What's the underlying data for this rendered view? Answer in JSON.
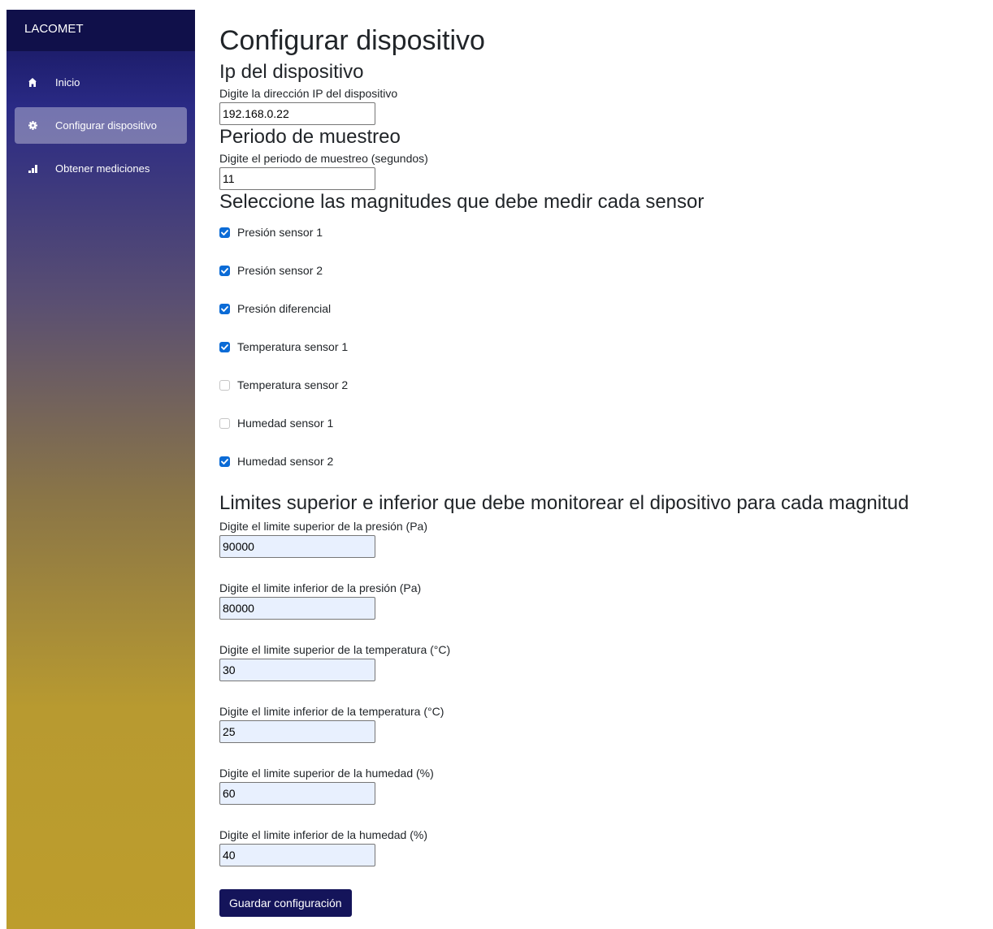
{
  "sidebar": {
    "brand": "LACOMET",
    "items": [
      {
        "label": "Inicio",
        "icon": "home-icon",
        "active": false
      },
      {
        "label": "Configurar dispositivo",
        "icon": "gear-icon",
        "active": true
      },
      {
        "label": "Obtener mediciones",
        "icon": "bar-chart-icon",
        "active": false
      }
    ]
  },
  "page": {
    "title": "Configurar dispositivo"
  },
  "ip_section": {
    "heading": "Ip del dispositivo",
    "label": "Digite la dirección IP del dispositivo",
    "value": "192.168.0.22"
  },
  "sampling_section": {
    "heading": "Periodo de muestreo",
    "label": "Digite el periodo de muestreo (segundos)",
    "value": "11"
  },
  "magnitudes_section": {
    "heading": "Seleccione las magnitudes que debe medir cada sensor",
    "options": [
      {
        "label": "Presión sensor 1",
        "checked": true
      },
      {
        "label": "Presión sensor 2",
        "checked": true
      },
      {
        "label": "Presión diferencial",
        "checked": true
      },
      {
        "label": "Temperatura sensor 1",
        "checked": true
      },
      {
        "label": "Temperatura sensor 2",
        "checked": false
      },
      {
        "label": "Humedad sensor 1",
        "checked": false
      },
      {
        "label": "Humedad sensor 2",
        "checked": true
      }
    ]
  },
  "limits_section": {
    "heading": "Limites superior e inferior que debe monitorear el dipositivo para cada magnitud",
    "fields": [
      {
        "label": "Digite el limite superior de la presión (Pa)",
        "value": "90000"
      },
      {
        "label": "Digite el limite inferior de la presión (Pa)",
        "value": "80000"
      },
      {
        "label": "Digite el limite superior de la temperatura (°C)",
        "value": "30"
      },
      {
        "label": "Digite el limite inferior de la temperatura (°C)",
        "value": "25"
      },
      {
        "label": "Digite el limite superior de la humedad (%)",
        "value": "60"
      },
      {
        "label": "Digite el limite inferior de la humedad (%)",
        "value": "40"
      }
    ]
  },
  "actions": {
    "save_label": "Guardar configuración"
  },
  "colors": {
    "sidebar_top": "#14145a",
    "sidebar_bottom": "#bd9d2c",
    "checkbox_checked": "#0b6bd6",
    "button": "#14145a",
    "autofill_input": "#e8f0fe"
  }
}
